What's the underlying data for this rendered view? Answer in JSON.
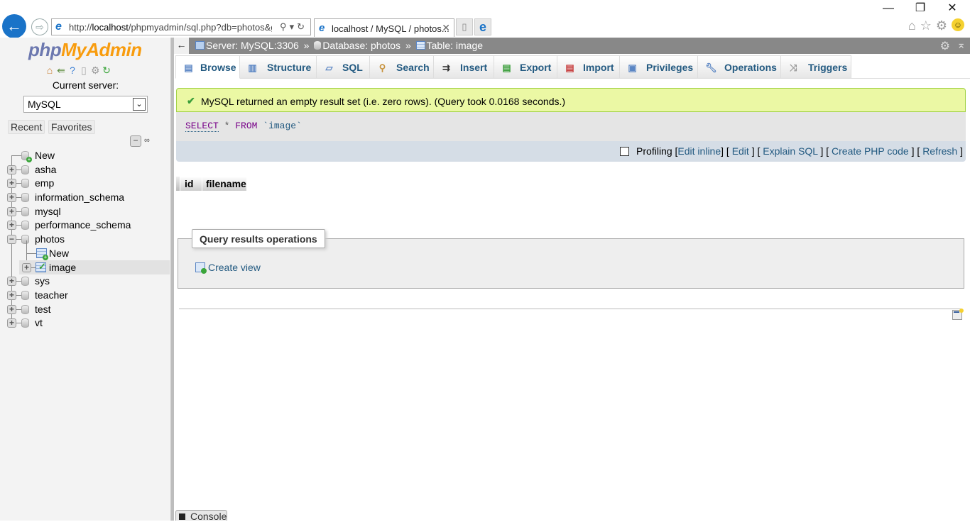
{
  "browser": {
    "address_url_prefix": "http://",
    "address_url_host": "localhost",
    "address_url_path": "/phpmyadmin/sql.php?db=photos&g",
    "tab_title": "localhost / MySQL / photos...",
    "window_controls": {
      "minimize": "—",
      "restore": "❐",
      "close": "✕"
    },
    "toolbar_icons": [
      "home-icon",
      "favorites-star-icon",
      "settings-gear-icon",
      "feedback-smiley-icon"
    ]
  },
  "nav": {
    "logo_php": "php",
    "logo_myadmin": "MyAdmin",
    "icons": [
      "home-icon",
      "logout-icon",
      "help-icon",
      "documentation-icon",
      "settings-icon",
      "reload-icon"
    ],
    "current_server_label": "Current server:",
    "server_select_value": "MySQL",
    "tabs": [
      "Recent",
      "Favorites"
    ],
    "tree": [
      {
        "label": "New",
        "type": "new"
      },
      {
        "label": "asha",
        "type": "db",
        "expanded": false
      },
      {
        "label": "emp",
        "type": "db",
        "expanded": false
      },
      {
        "label": "information_schema",
        "type": "db",
        "expanded": false
      },
      {
        "label": "mysql",
        "type": "db",
        "expanded": false
      },
      {
        "label": "performance_schema",
        "type": "db",
        "expanded": false
      },
      {
        "label": "photos",
        "type": "db",
        "expanded": true,
        "children": [
          {
            "label": "New",
            "type": "new-table"
          },
          {
            "label": "image",
            "type": "table",
            "selected": true
          }
        ]
      },
      {
        "label": "sys",
        "type": "db",
        "expanded": false
      },
      {
        "label": "teacher",
        "type": "db",
        "expanded": false
      },
      {
        "label": "test",
        "type": "db",
        "expanded": false
      },
      {
        "label": "vt",
        "type": "db",
        "expanded": false
      }
    ]
  },
  "breadcrumb": {
    "server": "Server: MySQL:3306",
    "database": "Database: photos",
    "table": "Table: image",
    "separator": "»"
  },
  "tabs": [
    {
      "label": "Browse",
      "icon": "browse-icon",
      "active": true
    },
    {
      "label": "Structure",
      "icon": "structure-icon"
    },
    {
      "label": "SQL",
      "icon": "sql-icon"
    },
    {
      "label": "Search",
      "icon": "search-icon"
    },
    {
      "label": "Insert",
      "icon": "insert-icon"
    },
    {
      "label": "Export",
      "icon": "export-icon"
    },
    {
      "label": "Import",
      "icon": "import-icon"
    },
    {
      "label": "Privileges",
      "icon": "privileges-icon"
    },
    {
      "label": "Operations",
      "icon": "operations-wrench-icon"
    },
    {
      "label": "Triggers",
      "icon": "triggers-icon"
    }
  ],
  "result": {
    "success_message": "MySQL returned an empty result set (i.e. zero rows). (Query took 0.0168 seconds.)",
    "query": {
      "select": "SELECT",
      "star": "*",
      "from": "FROM",
      "table": "`image`"
    },
    "profiling_label": "Profiling",
    "profiling_checked": false,
    "links": [
      "Edit inline",
      "Edit",
      "Explain SQL",
      "Create PHP code",
      "Refresh"
    ],
    "columns": [
      "id",
      "filename"
    ],
    "rows": []
  },
  "operations": {
    "legend": "Query results operations",
    "create_view": "Create view"
  },
  "console_label": "Console"
}
